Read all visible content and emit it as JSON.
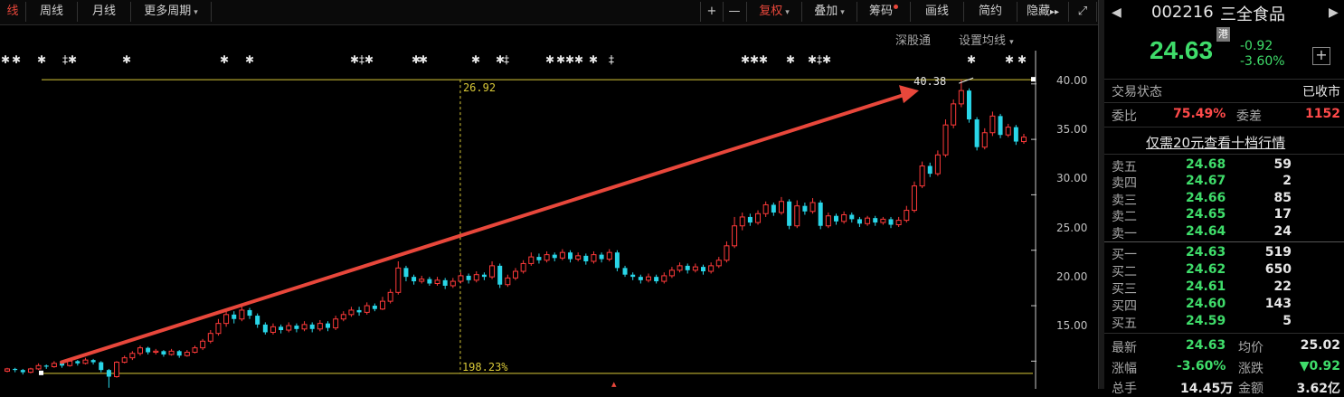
{
  "toolbar": {
    "left": [
      "线",
      "周线",
      "月线",
      "更多周期"
    ],
    "plus": "+",
    "minus": "—",
    "right": [
      "复权",
      "叠加",
      "筹码",
      "画线",
      "简约",
      "隐藏"
    ],
    "hide_arrows": "▸▸",
    "expand": "⤢"
  },
  "subtoolbar": {
    "sgt": "深股通",
    "ma_settings": "设置均线"
  },
  "chart": {
    "high_label": "26.92",
    "pct_label": "198.23%",
    "peak_label": "40.38",
    "y_ticks": [
      "40.00",
      "35.00",
      "30.00",
      "25.00",
      "20.00",
      "15.00"
    ],
    "colors": {
      "up": "#ff3a3a",
      "down": "#29d6e8",
      "accent": "#e8473b",
      "guide": "#d8c838"
    }
  },
  "chart_data": {
    "type": "candlestick",
    "ylim": [
      12.5,
      43.0
    ],
    "y_ticks": [
      15,
      20,
      25,
      30,
      35,
      40
    ],
    "candles": [
      [
        14.1,
        14.3,
        14.0,
        14.4
      ],
      [
        14.3,
        14.2,
        14.0,
        14.4
      ],
      [
        14.2,
        14.0,
        13.8,
        14.3
      ],
      [
        14.0,
        14.3,
        13.9,
        14.4
      ],
      [
        14.3,
        14.6,
        14.2,
        14.8
      ],
      [
        14.6,
        14.5,
        14.3,
        14.7
      ],
      [
        14.5,
        14.8,
        14.4,
        15.0
      ],
      [
        14.8,
        14.6,
        14.4,
        14.9
      ],
      [
        14.6,
        15.0,
        14.5,
        15.1
      ],
      [
        15.0,
        14.8,
        14.6,
        15.1
      ],
      [
        14.8,
        15.1,
        14.7,
        15.3
      ],
      [
        15.1,
        14.9,
        14.7,
        15.2
      ],
      [
        14.9,
        14.2,
        14.0,
        15.0
      ],
      [
        14.2,
        13.6,
        12.6,
        14.3
      ],
      [
        13.6,
        14.9,
        13.5,
        15.0
      ],
      [
        14.9,
        15.3,
        14.8,
        15.5
      ],
      [
        15.3,
        15.7,
        15.1,
        15.9
      ],
      [
        15.7,
        16.2,
        15.5,
        16.4
      ],
      [
        16.2,
        15.8,
        15.6,
        16.3
      ],
      [
        15.8,
        15.9,
        15.6,
        16.1
      ],
      [
        15.9,
        15.6,
        15.4,
        16.0
      ],
      [
        15.6,
        15.9,
        15.5,
        16.1
      ],
      [
        15.9,
        15.5,
        15.3,
        16.0
      ],
      [
        15.5,
        15.8,
        15.4,
        16.0
      ],
      [
        15.8,
        16.2,
        15.7,
        16.4
      ],
      [
        16.2,
        16.8,
        16.0,
        17.0
      ],
      [
        16.8,
        17.5,
        16.6,
        17.8
      ],
      [
        17.5,
        18.4,
        17.3,
        18.8
      ],
      [
        18.4,
        19.2,
        18.1,
        19.6
      ],
      [
        19.2,
        18.8,
        18.4,
        19.5
      ],
      [
        18.8,
        19.6,
        18.6,
        20.0
      ],
      [
        19.6,
        19.1,
        18.8,
        19.8
      ],
      [
        19.1,
        18.3,
        18.0,
        19.3
      ],
      [
        18.3,
        17.6,
        17.4,
        18.5
      ],
      [
        17.6,
        18.1,
        17.4,
        18.4
      ],
      [
        18.1,
        17.8,
        17.5,
        18.3
      ],
      [
        17.8,
        18.2,
        17.6,
        18.5
      ],
      [
        18.2,
        17.9,
        17.6,
        18.4
      ],
      [
        17.9,
        18.3,
        17.7,
        18.6
      ],
      [
        18.3,
        17.9,
        17.6,
        18.5
      ],
      [
        17.9,
        18.4,
        17.7,
        18.7
      ],
      [
        18.4,
        18.0,
        17.7,
        18.6
      ],
      [
        18.0,
        18.8,
        17.8,
        19.1
      ],
      [
        18.8,
        19.2,
        18.6,
        19.5
      ],
      [
        19.2,
        19.6,
        19.0,
        19.9
      ],
      [
        19.6,
        19.4,
        19.1,
        19.9
      ],
      [
        19.4,
        20.0,
        19.2,
        20.3
      ],
      [
        20.0,
        19.7,
        19.5,
        20.2
      ],
      [
        19.7,
        20.4,
        19.6,
        20.8
      ],
      [
        20.4,
        21.2,
        20.2,
        21.5
      ],
      [
        21.2,
        23.4,
        21.0,
        24.0
      ],
      [
        23.4,
        22.6,
        22.2,
        23.6
      ],
      [
        22.6,
        22.2,
        21.9,
        22.8
      ],
      [
        22.2,
        22.4,
        22.0,
        22.7
      ],
      [
        22.4,
        22.0,
        21.8,
        22.6
      ],
      [
        22.0,
        22.3,
        21.8,
        22.6
      ],
      [
        22.3,
        21.8,
        21.5,
        22.5
      ],
      [
        21.8,
        22.2,
        21.6,
        22.5
      ],
      [
        22.2,
        22.7,
        22.0,
        23.0
      ],
      [
        22.7,
        22.3,
        22.0,
        22.9
      ],
      [
        22.3,
        22.8,
        22.1,
        23.1
      ],
      [
        22.8,
        22.6,
        22.3,
        23.0
      ],
      [
        22.6,
        23.6,
        22.4,
        24.0
      ],
      [
        23.6,
        21.9,
        21.6,
        23.8
      ],
      [
        21.9,
        22.5,
        21.7,
        22.8
      ],
      [
        22.5,
        23.1,
        22.3,
        23.4
      ],
      [
        23.1,
        23.8,
        22.9,
        24.1
      ],
      [
        23.8,
        24.4,
        23.6,
        24.8
      ],
      [
        24.4,
        24.1,
        23.8,
        24.7
      ],
      [
        24.1,
        24.6,
        23.9,
        24.9
      ],
      [
        24.6,
        24.3,
        24.0,
        24.8
      ],
      [
        24.3,
        24.8,
        24.1,
        25.1
      ],
      [
        24.8,
        24.2,
        23.9,
        25.0
      ],
      [
        24.2,
        24.5,
        24.0,
        24.8
      ],
      [
        24.5,
        24.0,
        23.7,
        24.7
      ],
      [
        24.0,
        24.6,
        23.8,
        24.9
      ],
      [
        24.6,
        24.2,
        23.9,
        24.8
      ],
      [
        24.2,
        24.8,
        24.0,
        25.1
      ],
      [
        24.8,
        23.4,
        23.1,
        25.0
      ],
      [
        23.4,
        22.8,
        22.6,
        23.6
      ],
      [
        22.8,
        22.6,
        22.3,
        23.0
      ],
      [
        22.6,
        22.3,
        22.0,
        22.8
      ],
      [
        22.3,
        22.6,
        22.1,
        22.9
      ],
      [
        22.6,
        22.2,
        22.0,
        22.8
      ],
      [
        22.2,
        22.7,
        22.0,
        23.0
      ],
      [
        22.7,
        23.2,
        22.5,
        23.5
      ],
      [
        23.2,
        23.6,
        23.0,
        23.9
      ],
      [
        23.6,
        23.2,
        22.9,
        23.8
      ],
      [
        23.2,
        23.5,
        23.0,
        23.8
      ],
      [
        23.5,
        23.1,
        22.8,
        23.7
      ],
      [
        23.1,
        23.6,
        22.9,
        23.9
      ],
      [
        23.6,
        24.1,
        23.4,
        24.4
      ],
      [
        24.1,
        25.4,
        23.9,
        25.8
      ],
      [
        25.4,
        27.2,
        25.2,
        28.0
      ],
      [
        27.2,
        28.0,
        26.8,
        28.4
      ],
      [
        28.0,
        27.5,
        27.2,
        28.3
      ],
      [
        27.5,
        28.3,
        27.3,
        28.6
      ],
      [
        28.3,
        29.1,
        28.0,
        29.4
      ],
      [
        29.1,
        28.4,
        28.1,
        29.3
      ],
      [
        28.4,
        29.4,
        28.2,
        29.8
      ],
      [
        29.4,
        27.2,
        26.9,
        29.6
      ],
      [
        27.2,
        29.0,
        27.0,
        29.5
      ],
      [
        29.0,
        28.5,
        28.2,
        29.3
      ],
      [
        28.5,
        29.3,
        28.3,
        29.7
      ],
      [
        29.3,
        27.2,
        26.9,
        29.5
      ],
      [
        27.2,
        28.1,
        27.0,
        28.4
      ],
      [
        28.1,
        27.6,
        27.3,
        28.3
      ],
      [
        27.6,
        28.2,
        27.4,
        28.5
      ],
      [
        28.2,
        27.8,
        27.5,
        28.4
      ],
      [
        27.8,
        27.4,
        27.1,
        28.0
      ],
      [
        27.4,
        27.9,
        27.2,
        28.1
      ],
      [
        27.9,
        27.5,
        27.2,
        28.1
      ],
      [
        27.5,
        27.8,
        27.3,
        28.0
      ],
      [
        27.8,
        27.3,
        27.0,
        28.0
      ],
      [
        27.3,
        27.7,
        27.1,
        28.0
      ],
      [
        27.7,
        28.6,
        27.5,
        29.0
      ],
      [
        28.6,
        30.8,
        28.4,
        31.2
      ],
      [
        30.8,
        32.6,
        30.6,
        33.0
      ],
      [
        32.6,
        31.9,
        31.6,
        32.9
      ],
      [
        31.9,
        33.6,
        31.7,
        34.0
      ],
      [
        33.6,
        36.3,
        33.4,
        36.8
      ],
      [
        36.3,
        38.2,
        36.0,
        38.6
      ],
      [
        38.2,
        39.4,
        37.9,
        40.38
      ],
      [
        39.4,
        36.8,
        36.5,
        39.6
      ],
      [
        36.8,
        34.3,
        34.0,
        37.0
      ],
      [
        34.3,
        35.6,
        34.1,
        36.0
      ],
      [
        35.6,
        37.1,
        35.3,
        37.5
      ],
      [
        37.1,
        35.4,
        35.1,
        37.3
      ],
      [
        35.4,
        36.1,
        35.2,
        36.4
      ],
      [
        36.1,
        34.8,
        34.5,
        36.3
      ],
      [
        34.8,
        35.2,
        34.6,
        35.5
      ]
    ],
    "markers": [
      {
        "index": 51,
        "value": 26.92,
        "label": "26.92"
      },
      {
        "index": 124,
        "value": 40.38,
        "label": "40.38"
      }
    ],
    "range_low": 13.9,
    "range_high": 40.38,
    "change_pct": "198.23%"
  },
  "quote": {
    "code": "002216",
    "name": "三全食品",
    "price": "24.63",
    "change": "-0.92",
    "change_pct": "-3.60%",
    "hk_tag": "港",
    "add_btn": "+",
    "status_label": "交易状态",
    "status_value": "已收市",
    "weibi_label": "委比",
    "weibi_value": "75.49%",
    "weicha_label": "委差",
    "weicha_value": "1152",
    "promo": "仅需20元查看十档行情",
    "asks": [
      {
        "label": "卖五",
        "price": "24.68",
        "vol": "59"
      },
      {
        "label": "卖四",
        "price": "24.67",
        "vol": "2"
      },
      {
        "label": "卖三",
        "price": "24.66",
        "vol": "85"
      },
      {
        "label": "卖二",
        "price": "24.65",
        "vol": "17"
      },
      {
        "label": "卖一",
        "price": "24.64",
        "vol": "24"
      }
    ],
    "bids": [
      {
        "label": "买一",
        "price": "24.63",
        "vol": "519"
      },
      {
        "label": "买二",
        "price": "24.62",
        "vol": "650"
      },
      {
        "label": "买三",
        "price": "24.61",
        "vol": "22"
      },
      {
        "label": "买四",
        "price": "24.60",
        "vol": "143"
      },
      {
        "label": "买五",
        "price": "24.59",
        "vol": "5"
      }
    ],
    "latest_label": "最新",
    "latest_value": "24.63",
    "avg_label": "均价",
    "avg_value": "25.02",
    "zf_label": "涨幅",
    "zf_value": "-3.60%",
    "zd_label": "涨跌",
    "zd_value": "▼0.92",
    "zs_label": "总手",
    "zs_value": "14.45万",
    "je_label": "金额",
    "je_value": "3.62亿"
  }
}
